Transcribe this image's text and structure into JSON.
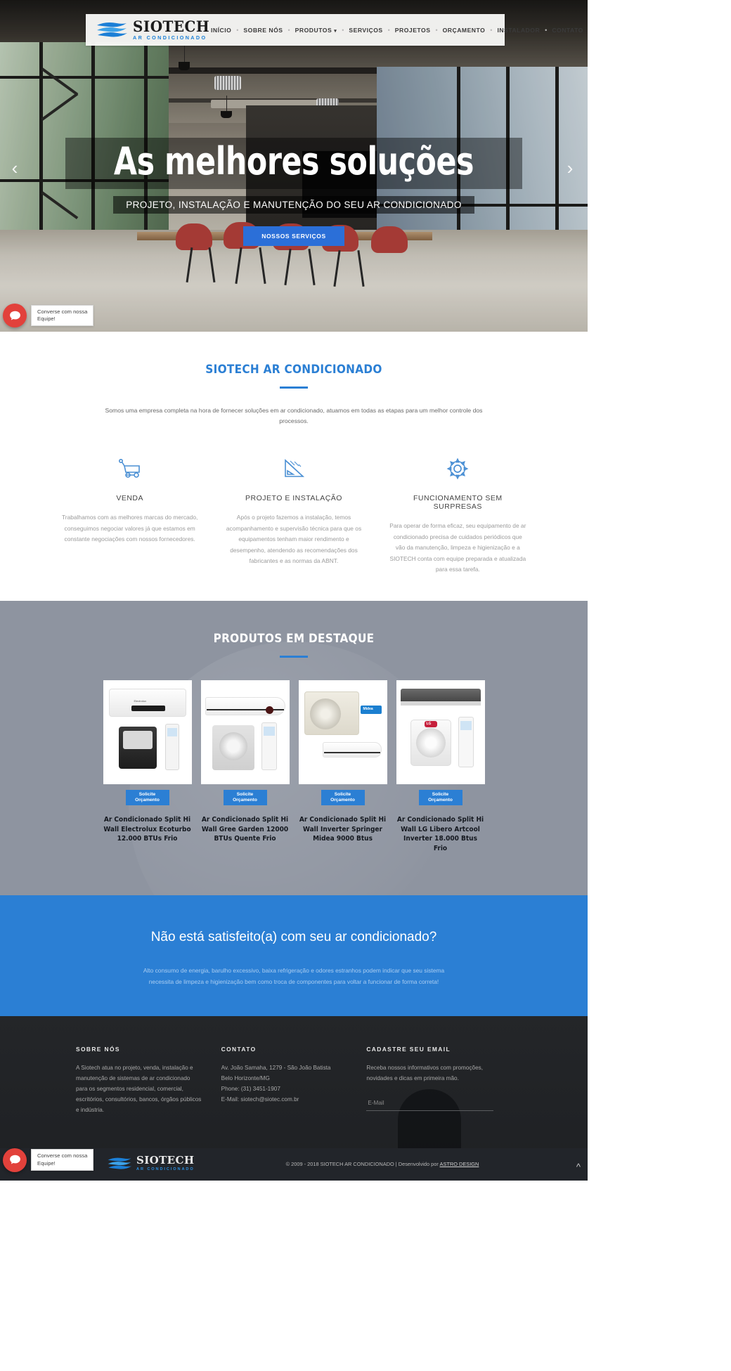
{
  "header": {
    "logo_name": "SIOTECH",
    "logo_tagline": "AR CONDICIONADO",
    "nav": [
      {
        "label": "INÍCIO",
        "has_caret": false
      },
      {
        "label": "SOBRE NÓS",
        "has_caret": false
      },
      {
        "label": "PRODUTOS",
        "has_caret": true
      },
      {
        "label": "SERVIÇOS",
        "has_caret": false
      },
      {
        "label": "PROJETOS",
        "has_caret": false
      },
      {
        "label": "ORÇAMENTO",
        "has_caret": false
      },
      {
        "label": "INSTALADOR",
        "has_caret": false
      },
      {
        "label": "CONTATO",
        "has_caret": false
      }
    ],
    "separator": "•"
  },
  "hero": {
    "title": "As melhores soluções",
    "subtitle": "PROJETO, INSTALAÇÃO E MANUTENÇÃO DO SEU AR CONDICIONADO",
    "button": "NOSSOS SERVIÇOS",
    "prev_arrow": "‹",
    "next_arrow": "›"
  },
  "about": {
    "title": "SIOTECH AR CONDICIONADO",
    "lead": "Somos uma empresa completa na hora de fornecer soluções em ar condicionado, atuamos em todas as etapas para um melhor controle dos processos.",
    "columns": [
      {
        "icon": "shopping-cart-icon",
        "title": "VENDA",
        "text": "Trabalhamos com as melhores marcas do mercado, conseguimos negociar valores já que estamos em constante negociações com nossos fornecedores."
      },
      {
        "icon": "ruler-triangle-icon",
        "title": "PROJETO E INSTALAÇÃO",
        "text": "Após o projeto fazemos a instalação, temos acompanhamento e supervisão técnica para que os equipamentos tenham maior rendimento e desempenho, atendendo as recomendações dos fabricantes e as normas da ABNT."
      },
      {
        "icon": "gear-icon",
        "title": "FUNCIONAMENTO SEM SURPRESAS",
        "text": "Para operar de forma eficaz, seu equipamento de ar condicionado precisa de cuidados periódicos que vão da manutenção, limpeza e higienização e a SIOTECH conta com equipe preparada e atualizada para essa tarefa."
      }
    ]
  },
  "products": {
    "title": "PRODUTOS EM DESTAQUE",
    "badge_line1": "Solicite",
    "badge_line2": "Orçamento",
    "items": [
      {
        "name": "Ar Condicionado Split Hi Wall Electrolux Ecoturbo 12.000 BTUs Frio",
        "brand": "Electrolux"
      },
      {
        "name": "Ar Condicionado Split Hi Wall Gree Garden 12000 BTUs Quente Frio",
        "brand": "Gree"
      },
      {
        "name": "Ar Condicionado Split Hi Wall Inverter Springer Midea 9000 Btus",
        "brand": "Midea"
      },
      {
        "name": "Ar Condicionado Split Hi Wall LG Libero Artcool Inverter 18.000 Btus Frio",
        "brand": "LG"
      }
    ]
  },
  "cta": {
    "heading": "Não está satisfeito(a) com seu ar condicionado?",
    "text": "Alto consumo de energia, barulho excessivo, baixa refrigeração e odores estranhos podem indicar que seu sistema necessita de  limpeza e higienização bem como troca de componentes para voltar a funcionar de forma correta!"
  },
  "footer": {
    "about": {
      "title": "SOBRE NÓS",
      "text": "A Siotech atua no projeto, venda, instalação e manutenção de sistemas de ar condicionado para os segmentos residencial, comercial, escritórios, consultórios, bancos, órgãos públicos e indústria."
    },
    "contact": {
      "title": "CONTATO",
      "address1": "Av. João Samaha, 1279 - São João Batista",
      "address2": "Belo Horizonte/MG",
      "phone": "Phone: (31) 3451-1907",
      "email": "E-Mail: siotech@siotec.com.br"
    },
    "newsletter": {
      "title": "CADASTRE SEU EMAIL",
      "text": "Receba nossos informativos com promoções, novidades e dicas em primeira mão.",
      "input_placeholder": "E-Mail"
    },
    "bar": {
      "logo_name": "SIOTECH",
      "logo_tagline": "AR CONDICIONADO",
      "copyright": "© 2009 - 2018 SIOTECH AR CONDICIONADO | Desenvolvido por ",
      "credit_link": "ASTRO DESIGN"
    },
    "scroll_top_icon": "^"
  },
  "chat_widget": {
    "line1": "Converse com nossa",
    "line2": "Equipe!"
  },
  "colors": {
    "brand_blue": "#2b7fd4",
    "logo_blue": "#1c7fd6",
    "products_bg": "#8e94a0",
    "footer_bg": "#2e3033",
    "footer_bar_bg": "#22252a",
    "chat_red": "#e2413b"
  }
}
